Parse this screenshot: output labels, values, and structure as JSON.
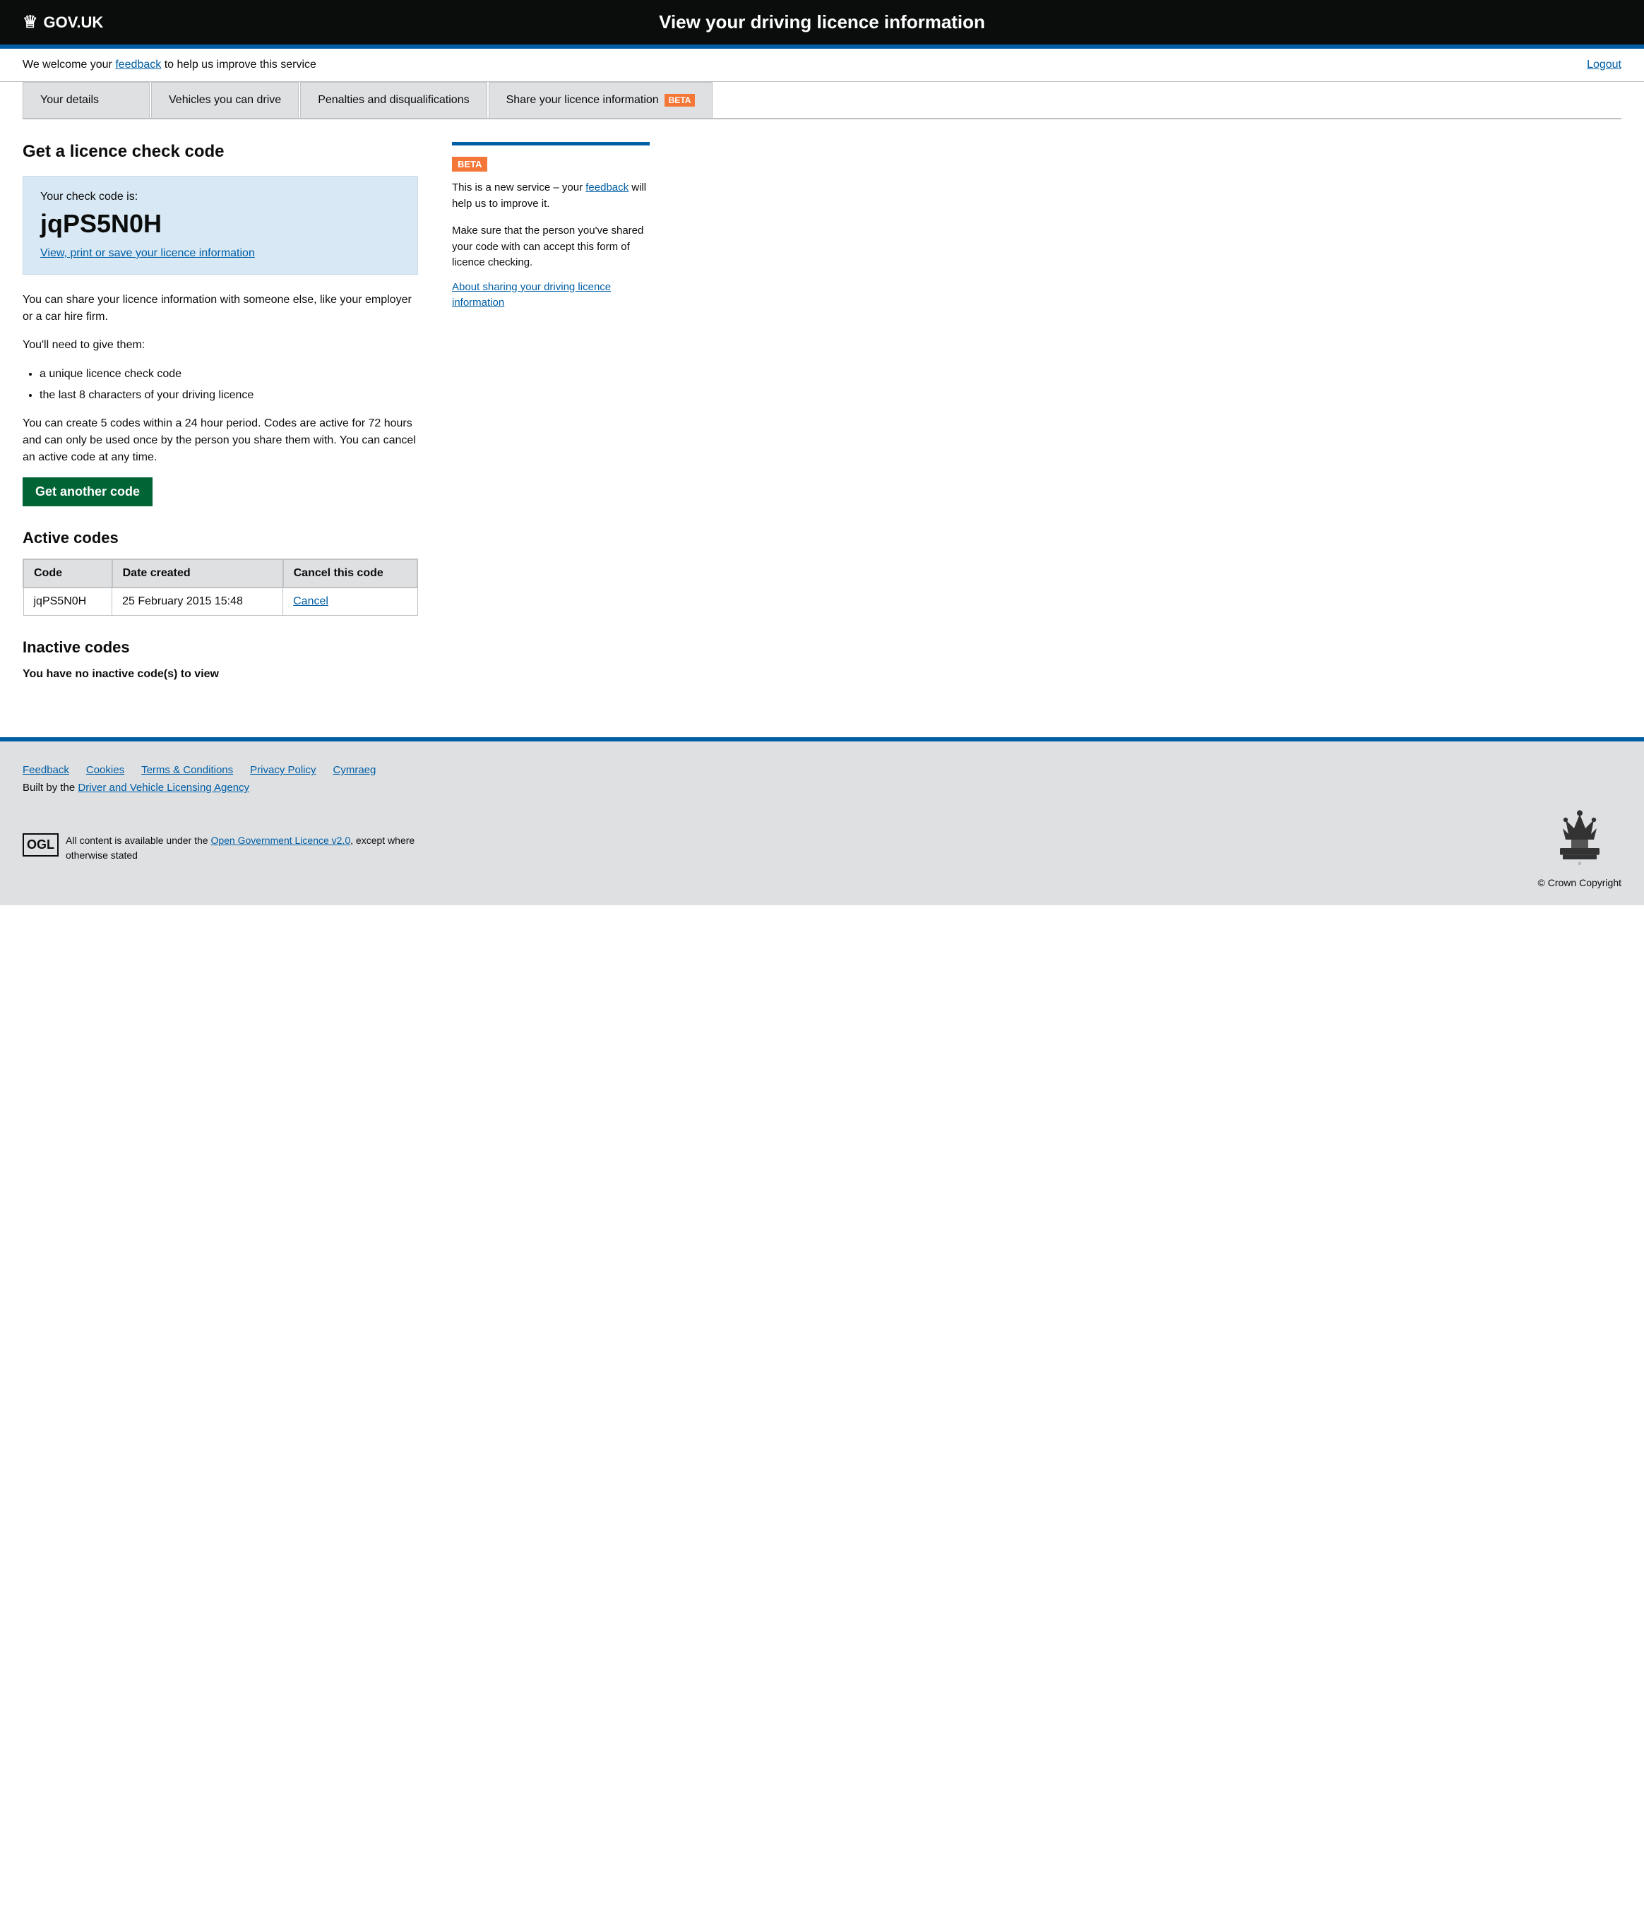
{
  "header": {
    "logo_text": "GOV.UK",
    "title": "View your driving licence information"
  },
  "welcome_bar": {
    "text": "We welcome your ",
    "feedback_link": "feedback",
    "text2": " to help us improve this service",
    "logout": "Logout"
  },
  "nav": {
    "tabs": [
      {
        "label": "Your details",
        "active": false
      },
      {
        "label": "Vehicles you can drive",
        "active": false
      },
      {
        "label": "Penalties and disqualifications",
        "active": false
      },
      {
        "label": "Share your licence information",
        "active": true,
        "beta": "BETA"
      }
    ]
  },
  "main": {
    "page_heading": "Get a licence check code",
    "check_code_box": {
      "label": "Your check code is:",
      "code": "jqPS5N0H",
      "link_text": "View, print or save your licence information"
    },
    "body_paragraphs": [
      "You can share your licence information with someone else, like your employer or a car hire firm.",
      "You'll need to give them:"
    ],
    "bullet_list": [
      "a unique licence check code",
      "the last 8 characters of your driving licence"
    ],
    "info_paragraph": "You can create 5 codes within a 24 hour period. Codes are active for 72 hours and can only be used once by the person you share them with. You can cancel an active code at any time.",
    "get_another_code_btn": "Get another code",
    "active_codes_heading": "Active codes",
    "active_codes_table": {
      "headers": [
        "Code",
        "Date created",
        "Cancel this code"
      ],
      "rows": [
        {
          "code": "jqPS5N0H",
          "date_created": "25 February 2015 15:48",
          "cancel_link": "Cancel"
        }
      ]
    },
    "inactive_codes_heading": "Inactive codes",
    "no_inactive_text": "You have no inactive code(s) to view"
  },
  "sidebar": {
    "beta_badge": "BETA",
    "beta_text_before": "This is a new service – your ",
    "beta_feedback_link": "feedback",
    "beta_text_after": " will help us to improve it.",
    "warning_text": "Make sure that the person you've shared your code with can accept this form of licence checking.",
    "about_link": "About sharing your driving licence information"
  },
  "footer": {
    "links": [
      {
        "label": "Feedback"
      },
      {
        "label": "Cookies"
      },
      {
        "label": "Terms & Conditions"
      },
      {
        "label": "Privacy Policy"
      },
      {
        "label": "Cymraeg"
      }
    ],
    "built_by_text": "Built by the ",
    "built_by_link": "Driver and Vehicle Licensing Agency",
    "ogl_logo": "OGL",
    "ogl_text": "All content is available under the ",
    "ogl_link": "Open Government Licence v2.0",
    "ogl_text2": ", except where otherwise stated",
    "copyright": "© Crown Copyright"
  }
}
